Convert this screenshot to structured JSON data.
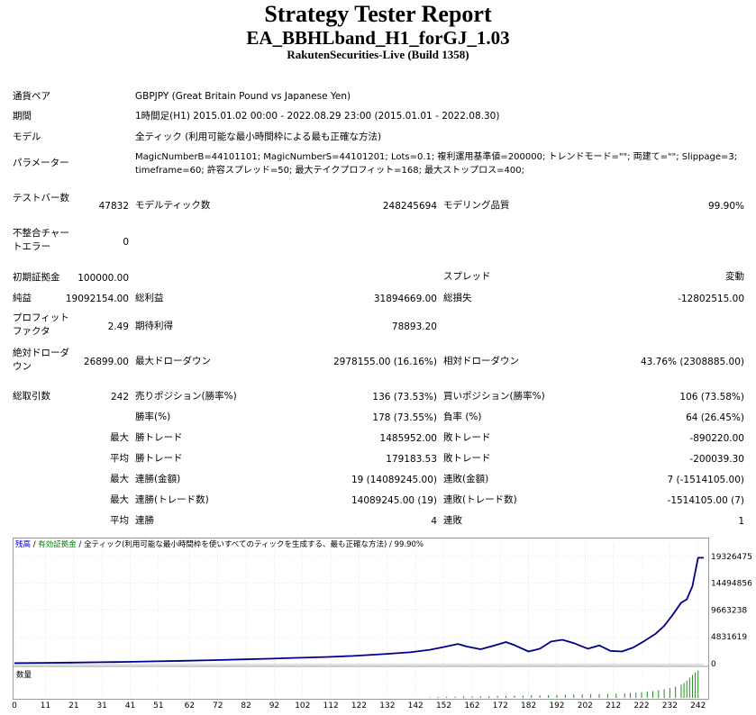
{
  "header": {
    "title": "Strategy Tester Report",
    "ea_name": "EA_BBHLband_H1_forGJ_1.03",
    "server": "RakutenSecurities-Live (Build 1358)"
  },
  "info": {
    "symbol_label": "通貨ペア",
    "symbol_value": "GBPJPY (Great Britain Pound vs Japanese Yen)",
    "period_label": "期間",
    "period_value": "1時間足(H1) 2015.01.02 00:00 - 2022.08.29 23:00 (2015.01.01 - 2022.08.30)",
    "model_label": "モデル",
    "model_value": "全ティック (利用可能な最小時間枠による最も正確な方法)",
    "params_label": "パラメーター",
    "params_line1": "MagicNumberB=44101101; MagicNumberS=44101201; Lots=0.1; 複利運用基準値=200000; トレンドモード=\"\"; 両建て=\"\"; Slippage=3;",
    "params_line2": "timeframe=60; 許容スプレッド=50; 最大テイクプロフィット=168; 最大ストップロス=400;"
  },
  "stats": {
    "bars_label": "テストバー数",
    "bars_value": "47832",
    "ticks_label": "モデルティック数",
    "ticks_value": "248245694",
    "quality_label": "モデリング品質",
    "quality_value": "99.90%",
    "mismatch_label": "不整合チャートエラー",
    "mismatch_value": "0",
    "deposit_label": "初期証拠金",
    "deposit_value": "100000.00",
    "spread_label": "スプレッド",
    "spread_value": "変動",
    "net_label": "純益",
    "net_value": "19092154.00",
    "gross_profit_label": "総利益",
    "gross_profit_value": "31894669.00",
    "gross_loss_label": "総損失",
    "gross_loss_value": "-12802515.00",
    "pf_label": "プロフィットファクタ",
    "pf_value": "2.49",
    "payoff_label": "期待利得",
    "payoff_value": "78893.20",
    "abs_dd_label": "絶対ドローダウン",
    "abs_dd_value": "26899.00",
    "max_dd_label": "最大ドローダウン",
    "max_dd_value": "2978155.00 (16.16%)",
    "rel_dd_label": "相対ドローダウン",
    "rel_dd_value": "43.76% (2308885.00)",
    "trades_label": "総取引数",
    "trades_value": "242",
    "short_label": "売りポジション(勝率%)",
    "short_value": "136 (73.53%)",
    "long_label": "買いポジション(勝率%)",
    "long_value": "106 (73.58%)",
    "win_label": "勝率(%)",
    "win_value": "178 (73.55%)",
    "loss_label": "負率 (%)",
    "loss_value": "64 (26.45%)",
    "max_prefix": "最大",
    "avg_prefix": "平均",
    "largest_win_label": "勝トレード",
    "largest_win_value": "1485952.00",
    "largest_loss_label": "敗トレード",
    "largest_loss_value": "-890220.00",
    "avg_win_label": "勝トレード",
    "avg_win_value": "179183.53",
    "avg_loss_label": "敗トレード",
    "avg_loss_value": "-200039.30",
    "cons_wins_label": "連勝(金額)",
    "cons_wins_value": "19 (14089245.00)",
    "cons_losses_label": "連敗(金額)",
    "cons_losses_value": "7 (-1514105.00)",
    "cons_profit_label": "連勝(トレード数)",
    "cons_profit_value": "14089245.00 (19)",
    "cons_loss_label": "連敗(トレード数)",
    "cons_loss_value": "-1514105.00 (7)",
    "avg_cons_wins_label": "連勝",
    "avg_cons_wins_value": "4",
    "avg_cons_losses_label": "連敗",
    "avg_cons_losses_value": "1"
  },
  "chart_data": {
    "type": "line",
    "legend": {
      "balance": "残高",
      "equity": "有効証拠金",
      "model": "全ティック(利用可能な最小時間枠を使いすべてのティックを生成する、最も正確な方法)",
      "quality": "99.90%",
      "sep": " / "
    },
    "volume_label": "数量",
    "y_ticks": [
      "19326475",
      "14494856",
      "9663238",
      "4831619",
      "0"
    ],
    "y_tick_values": [
      19326475,
      14494856,
      9663238,
      4831619,
      0
    ],
    "ylim": [
      0,
      20300000
    ],
    "x_ticks": [
      "0",
      "11",
      "21",
      "31",
      "41",
      "51",
      "62",
      "72",
      "82",
      "92",
      "102",
      "112",
      "122",
      "132",
      "142",
      "152",
      "162",
      "172",
      "182",
      "192",
      "202",
      "212",
      "222",
      "232",
      "242"
    ],
    "xlim": [
      0,
      244
    ],
    "colors": {
      "balance": "#00008b",
      "equity": "#008000",
      "volume": "#1f8f1f",
      "legend_balance": "#0000cd",
      "legend_equity": "#008000"
    },
    "balance": [
      [
        0,
        100000
      ],
      [
        10,
        150000
      ],
      [
        20,
        200000
      ],
      [
        30,
        260000
      ],
      [
        40,
        330000
      ],
      [
        50,
        420000
      ],
      [
        60,
        520000
      ],
      [
        70,
        640000
      ],
      [
        80,
        760000
      ],
      [
        90,
        900000
      ],
      [
        100,
        1050000
      ],
      [
        110,
        1200000
      ],
      [
        120,
        1400000
      ],
      [
        130,
        1700000
      ],
      [
        140,
        2050000
      ],
      [
        147,
        2500000
      ],
      [
        152,
        3000000
      ],
      [
        157,
        3550000
      ],
      [
        160,
        3100000
      ],
      [
        165,
        2600000
      ],
      [
        170,
        3300000
      ],
      [
        174,
        3900000
      ],
      [
        177,
        3350000
      ],
      [
        182,
        2200000
      ],
      [
        186,
        2700000
      ],
      [
        190,
        4000000
      ],
      [
        194,
        4300000
      ],
      [
        198,
        3700000
      ],
      [
        203,
        2700000
      ],
      [
        207,
        3300000
      ],
      [
        211,
        2300000
      ],
      [
        215,
        2200000
      ],
      [
        219,
        2900000
      ],
      [
        223,
        4100000
      ],
      [
        227,
        5400000
      ],
      [
        230,
        6800000
      ],
      [
        233,
        8800000
      ],
      [
        236,
        11000000
      ],
      [
        238,
        11600000
      ],
      [
        240,
        14000000
      ],
      [
        242,
        19092154
      ],
      [
        244,
        19092154
      ]
    ],
    "volumes": [
      [
        147,
        2
      ],
      [
        150,
        3
      ],
      [
        153,
        4
      ],
      [
        156,
        4
      ],
      [
        159,
        5
      ],
      [
        162,
        5
      ],
      [
        165,
        6
      ],
      [
        168,
        6
      ],
      [
        171,
        7
      ],
      [
        174,
        7
      ],
      [
        177,
        8
      ],
      [
        180,
        8
      ],
      [
        183,
        9
      ],
      [
        186,
        9
      ],
      [
        189,
        10
      ],
      [
        192,
        11
      ],
      [
        195,
        11
      ],
      [
        198,
        12
      ],
      [
        201,
        12
      ],
      [
        204,
        13
      ],
      [
        207,
        13
      ],
      [
        210,
        14
      ],
      [
        213,
        15
      ],
      [
        216,
        16
      ],
      [
        218,
        17
      ],
      [
        220,
        18
      ],
      [
        222,
        20
      ],
      [
        224,
        22
      ],
      [
        226,
        24
      ],
      [
        228,
        27
      ],
      [
        230,
        30
      ],
      [
        232,
        34
      ],
      [
        234,
        39
      ],
      [
        236,
        46
      ],
      [
        237,
        52
      ],
      [
        238,
        60
      ],
      [
        239,
        70
      ],
      [
        240,
        80
      ],
      [
        241,
        88
      ],
      [
        242,
        95
      ]
    ],
    "volume_max": 100
  }
}
